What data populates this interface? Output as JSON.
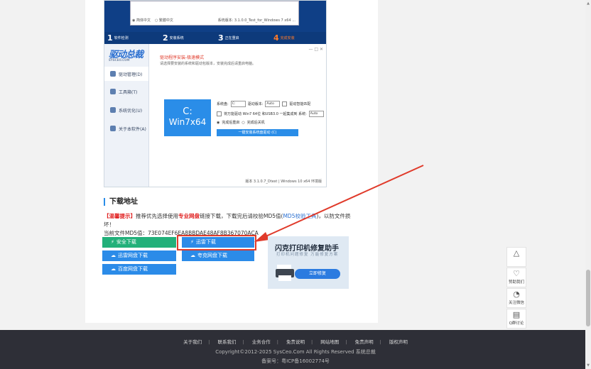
{
  "screenshot": {
    "inner_status": [
      "◉ 简体中文",
      "○ 繁體中文",
      "系统版本: 3.1.0.0_Test_for_Windows 7 x64 ..."
    ],
    "steps": [
      {
        "num": "1",
        "label": "软件检测"
      },
      {
        "num": "2",
        "label": "安装系统"
      },
      {
        "num": "3",
        "label": "正在重启"
      },
      {
        "num": "4",
        "label": "完成安装"
      }
    ],
    "app": {
      "logo": "驱动总裁",
      "logo_sub": "SYSCEO.COM",
      "nav": [
        "驱动管理(D)",
        "工具箱(T)",
        "系统优化(U)",
        "关于本软件(A)"
      ],
      "title": "驱动程序安装-极速模式",
      "subtitle": "请选择要安装的系统和驱动包版本，安装完成后请重启电脑。",
      "window_controls": "— □ ✕",
      "drive_letter": "C:",
      "drive_label": "Win7x64",
      "opt1_a": "系统盘:",
      "opt1_a_val": "C:",
      "opt1_b": "驱动版本:",
      "opt1_b_val": "Auto",
      "opt1_c": "驱动智能匹配",
      "opt2": "将万能驱动 Win7 64位 和USB3.0 一起集成到 系统:",
      "opt2_val": "Auto",
      "opt3_a": "完成后重启",
      "opt3_b": "完成后关机",
      "start": "一键安装系统盘驱动 (C)",
      "version": "版本 3.1.0.7_Dtest | Windows 10 x64 环境版"
    }
  },
  "download": {
    "section_title": "下载地址",
    "notice_tag": "【温馨提示】",
    "notice_line1_a": "推荐优先选择使用",
    "notice_highlight": "专业网盘",
    "notice_line1_b": "链接下载，下载完后请校验MD5值(",
    "notice_link": "MD5校验工具",
    "notice_line1_c": ")，以防文件损坏！",
    "notice_line2": "当前文件MD5值：73E074EF6EA8BBDAE48AF8B367070ACA",
    "buttons": [
      {
        "label": "安全下载",
        "icon": "⚡"
      },
      {
        "label": "迅雷下载",
        "icon": "⚡"
      },
      {
        "label": "迅雷网盘下载",
        "icon": "☁"
      },
      {
        "label": "夸克网盘下载",
        "icon": "☁"
      },
      {
        "label": "百度网盘下载",
        "icon": "☁"
      }
    ]
  },
  "ad": {
    "title": "闪克打印机修复助手",
    "subtitle": "打印机问题修复 万能修复方案",
    "button": "立即修复"
  },
  "float_tools": [
    {
      "icon": "arrow-up-icon",
      "label": ""
    },
    {
      "icon": "handshake-icon",
      "label": "赞助我们"
    },
    {
      "icon": "wechat-icon",
      "label": "关注微信"
    },
    {
      "icon": "chat-icon",
      "label": "Q群讨论"
    }
  ],
  "footer": {
    "links": [
      "关于我们",
      "联系我们",
      "业务合作",
      "免责说明",
      "网站地图",
      "免责声明",
      "版权声明"
    ],
    "copyright": "Copyright©2012-2025 SysCeo.Com All Rights Reserved 系统总裁",
    "icp": "备案号：粤ICP备16002774号"
  }
}
